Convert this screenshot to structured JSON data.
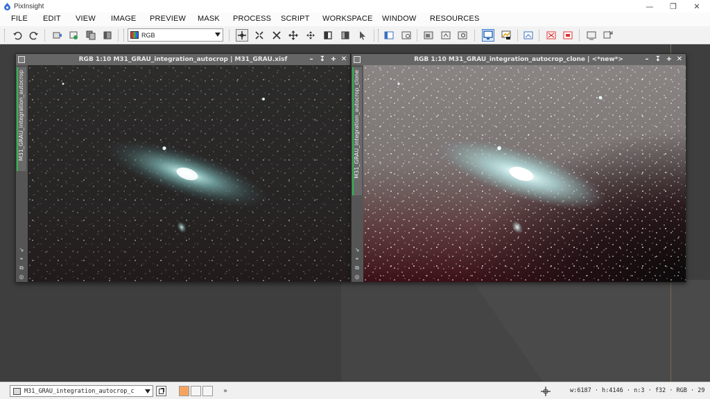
{
  "app": {
    "title": "PixInsight"
  },
  "menu": [
    "FILE",
    "EDIT",
    "VIEW",
    "IMAGE",
    "PREVIEW",
    "MASK",
    "PROCESS",
    "SCRIPT",
    "WORKSPACE",
    "WINDOW",
    "RESOURCES"
  ],
  "toolbar": {
    "color_mode": "RGB"
  },
  "windows": [
    {
      "title": "RGB 1:10 M31_GRAU_integration_autocrop | M31_GRAU.xisf",
      "view_id": "M31_GRAU_integration_autocrop"
    },
    {
      "title": "RGB 1:10 M31_GRAU_integration_autocrop_clone | <*new*>",
      "view_id": "M31_GRAU_integration_autocrop_clone"
    }
  ],
  "status": {
    "view_selector": "M31_GRAU_integration_autocrop_c",
    "more": "»",
    "info": "w:6187 · h:4146 · n:3 · f32 · RGB · 29"
  },
  "colors": {
    "accent_tab": "#2fb84f",
    "stf_swatch": "#f4a460"
  }
}
